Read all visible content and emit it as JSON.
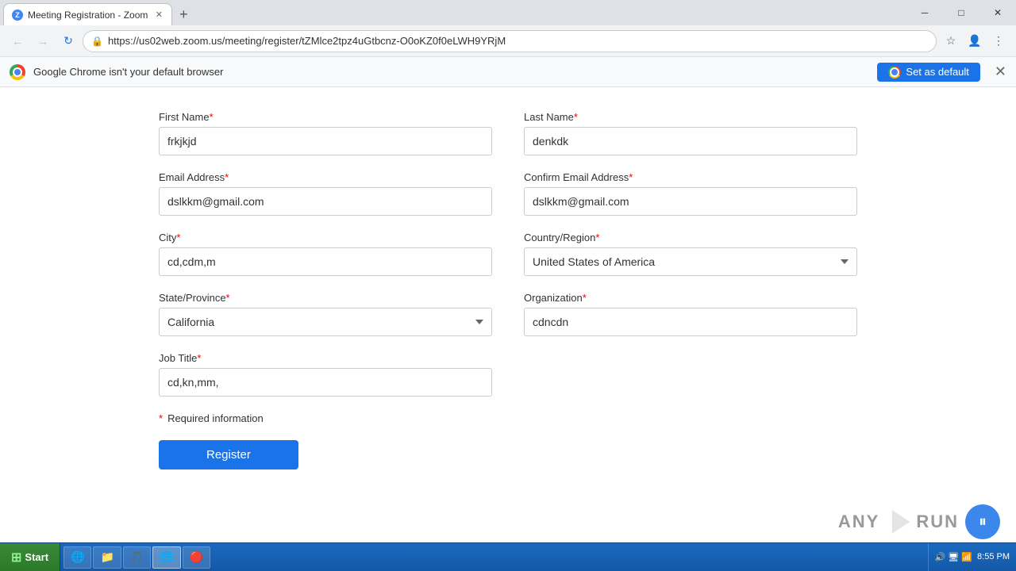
{
  "browser": {
    "tab_title": "Meeting Registration - Zoom",
    "url": "https://us02web.zoom.us/meeting/register/tZMlce2tpz4uGtbcnz-O0oKZ0f0eLWH9YRjM",
    "notification_text": "Google Chrome isn't your default browser",
    "set_default_label": "Set as default"
  },
  "form": {
    "first_name_label": "First Name",
    "first_name_value": "frkjkjd",
    "last_name_label": "Last Name",
    "last_name_value": "denkdk",
    "email_label": "Email Address",
    "email_value": "dslkkm@gmail.com",
    "confirm_email_label": "Confirm Email Address",
    "confirm_email_value": "dslkkm@gmail.com",
    "city_label": "City",
    "city_value": "cd,cdm,m",
    "country_label": "Country/Region",
    "country_value": "United States of America",
    "state_label": "State/Province",
    "state_value": "California",
    "org_label": "Organization",
    "org_value": "cdncdn",
    "job_title_label": "Job Title",
    "job_title_value": "cd,kn,mm,",
    "required_note": "Required information",
    "register_btn": "Register"
  },
  "taskbar": {
    "start_label": "Start",
    "time": "8:55 PM"
  }
}
